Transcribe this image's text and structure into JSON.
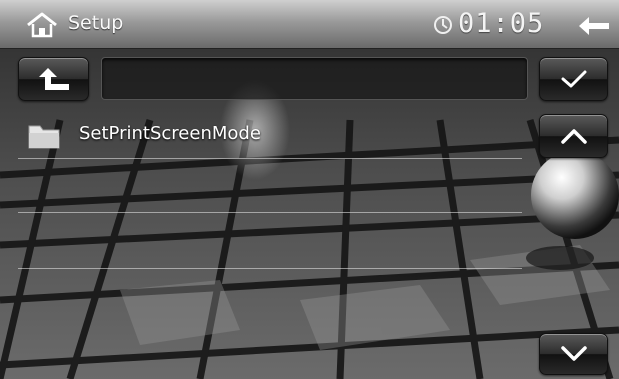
{
  "header": {
    "title": "Setup",
    "time": "01:05"
  },
  "path": {
    "value": ""
  },
  "list": {
    "items": [
      {
        "label": "SetPrintScreenMode"
      }
    ]
  }
}
